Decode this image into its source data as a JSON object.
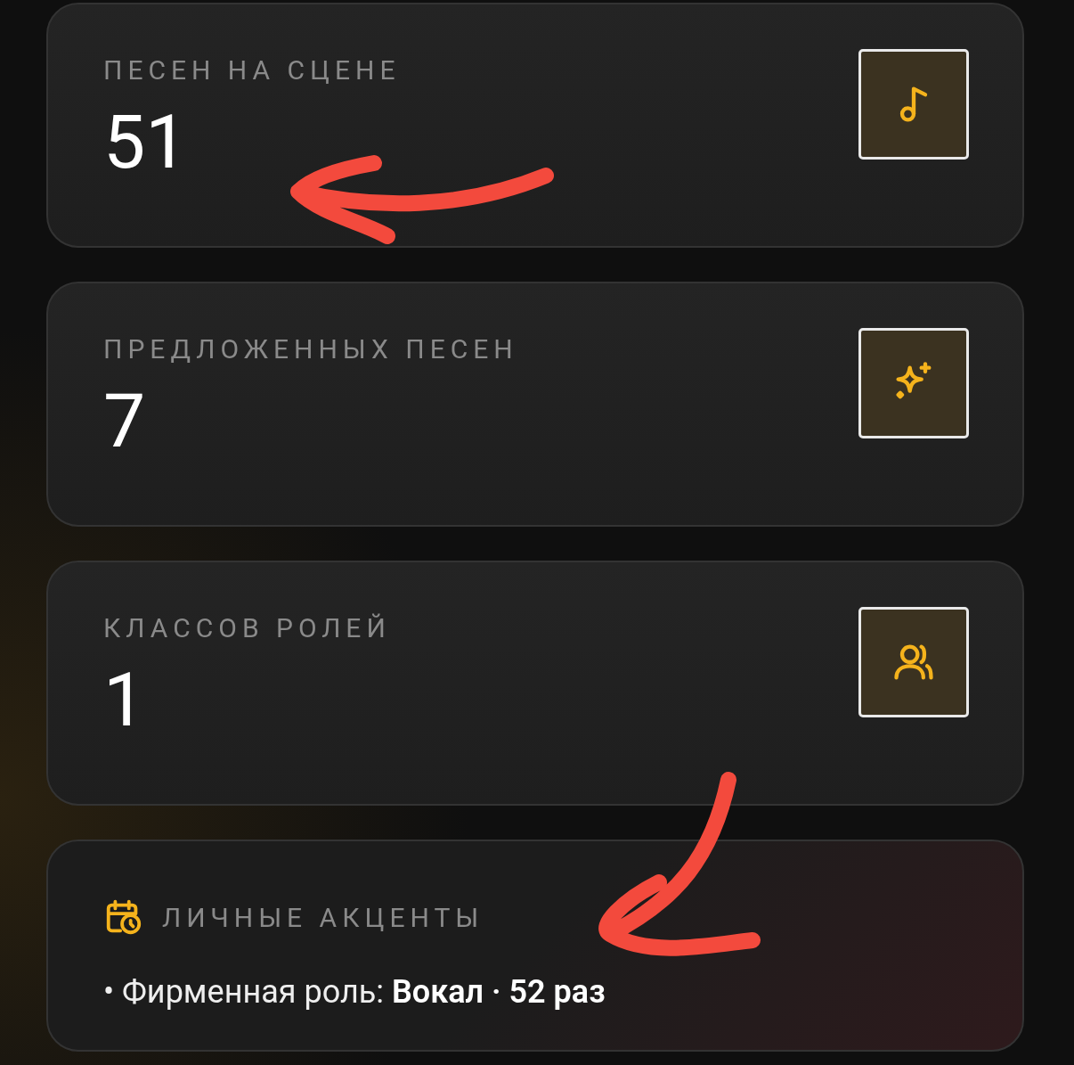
{
  "stats": [
    {
      "label": "ПЕСЕН НА СЦЕНЕ",
      "value": "51",
      "kind": "note"
    },
    {
      "label": "ПРЕДЛОЖЕННЫХ ПЕСЕН",
      "value": "7",
      "kind": "sparkle"
    },
    {
      "label": "КЛАССОВ РОЛЕЙ",
      "value": "1",
      "kind": "users"
    }
  ],
  "highlights": {
    "title": "ЛИЧНЫЕ АКЦЕНТЫ",
    "items": [
      "• Фирменная роль: **Вокал · 52 раз**"
    ]
  },
  "annotations": [
    {
      "kind": "arrow"
    },
    {
      "kind": "arrow"
    }
  ]
}
